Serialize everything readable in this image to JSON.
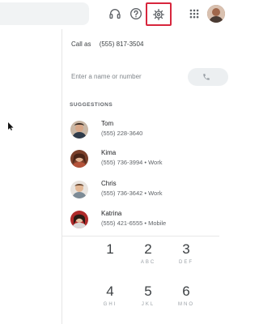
{
  "header": {
    "icons": [
      "headset-icon",
      "help-icon",
      "gear-icon",
      "apps-grid-icon"
    ],
    "highlight_color": "#d7263d"
  },
  "call_panel": {
    "call_as_label": "Call as",
    "call_as_number": "(555) 817-3504",
    "input_placeholder": "Enter a name or number",
    "suggestions_title": "SUGGESTIONS"
  },
  "contacts": [
    {
      "name": "Tom",
      "detail": "(555) 228-3640"
    },
    {
      "name": "Kima",
      "detail": "(555) 736-3994 • Work"
    },
    {
      "name": "Chris",
      "detail": "(555) 736-3642 • Work"
    },
    {
      "name": "Katrina",
      "detail": "(555) 421-6555 • Mobile"
    }
  ],
  "dialpad": [
    {
      "digit": "1",
      "letters": ""
    },
    {
      "digit": "2",
      "letters": "ABC"
    },
    {
      "digit": "3",
      "letters": "DEF"
    },
    {
      "digit": "4",
      "letters": "GHI"
    },
    {
      "digit": "5",
      "letters": "JKL"
    },
    {
      "digit": "6",
      "letters": "MNO"
    }
  ]
}
